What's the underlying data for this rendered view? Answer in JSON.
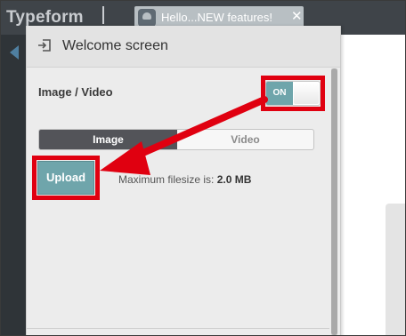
{
  "app": {
    "logo": "Typeform"
  },
  "tab": {
    "title": "Hello...NEW features!",
    "close": "✕"
  },
  "panel": {
    "title": "Welcome screen",
    "section_label": "Image / Video",
    "toggle": {
      "state_label": "ON",
      "value": true
    },
    "segmented": {
      "options": [
        "Image",
        "Video"
      ],
      "selected": "Image"
    },
    "upload_button": "Upload",
    "filesize_prefix": "Maximum filesize is:",
    "filesize_value": "2.0 MB"
  },
  "annotation": {
    "color": "#e00010"
  },
  "colors": {
    "accent": "#6fa5ab",
    "topbar": "#3f4449",
    "segment_active": "#535459"
  },
  "icons": {
    "header": "enter-icon",
    "back": "back-arrow-icon",
    "tab_avatar": "avatar-icon"
  }
}
